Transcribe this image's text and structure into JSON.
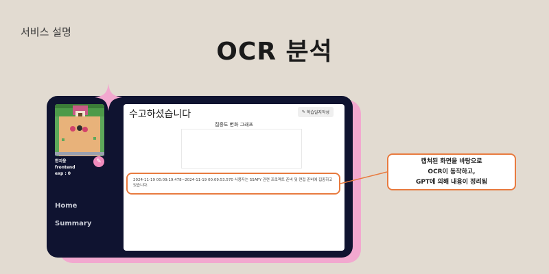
{
  "slide": {
    "section_label": "서비스 설명",
    "headline": "OCR 분석"
  },
  "sidebar": {
    "user_name": "한지웅",
    "user_role": "frontend",
    "user_exp": "exp : 0",
    "edit_icon": "pencil-icon",
    "nav": [
      {
        "label": "Home"
      },
      {
        "label": "Summary"
      }
    ]
  },
  "main": {
    "title": "수고하셨습니다",
    "journal_button": "학습일지작성",
    "journal_icon": "pencil-icon",
    "chart_title": "집중도 변화 그래프",
    "log_text": "2024-11-19 00:09:19.478~2024-11-19 00:09:53.570 사용자는 SSAFY 관련 프로젝트 준비 및 면접 준비에 집중하고 있습니다."
  },
  "callout": {
    "lines": [
      "캡쳐된 화면을 바탕으로",
      "OCR이 동작하고,",
      "GPT에 의해 내용이 정리됨"
    ]
  },
  "colors": {
    "background": "#e2dbd1",
    "device": "#0f1330",
    "accent_pink": "#f2a8cf",
    "highlight_orange": "#e87a3e"
  }
}
